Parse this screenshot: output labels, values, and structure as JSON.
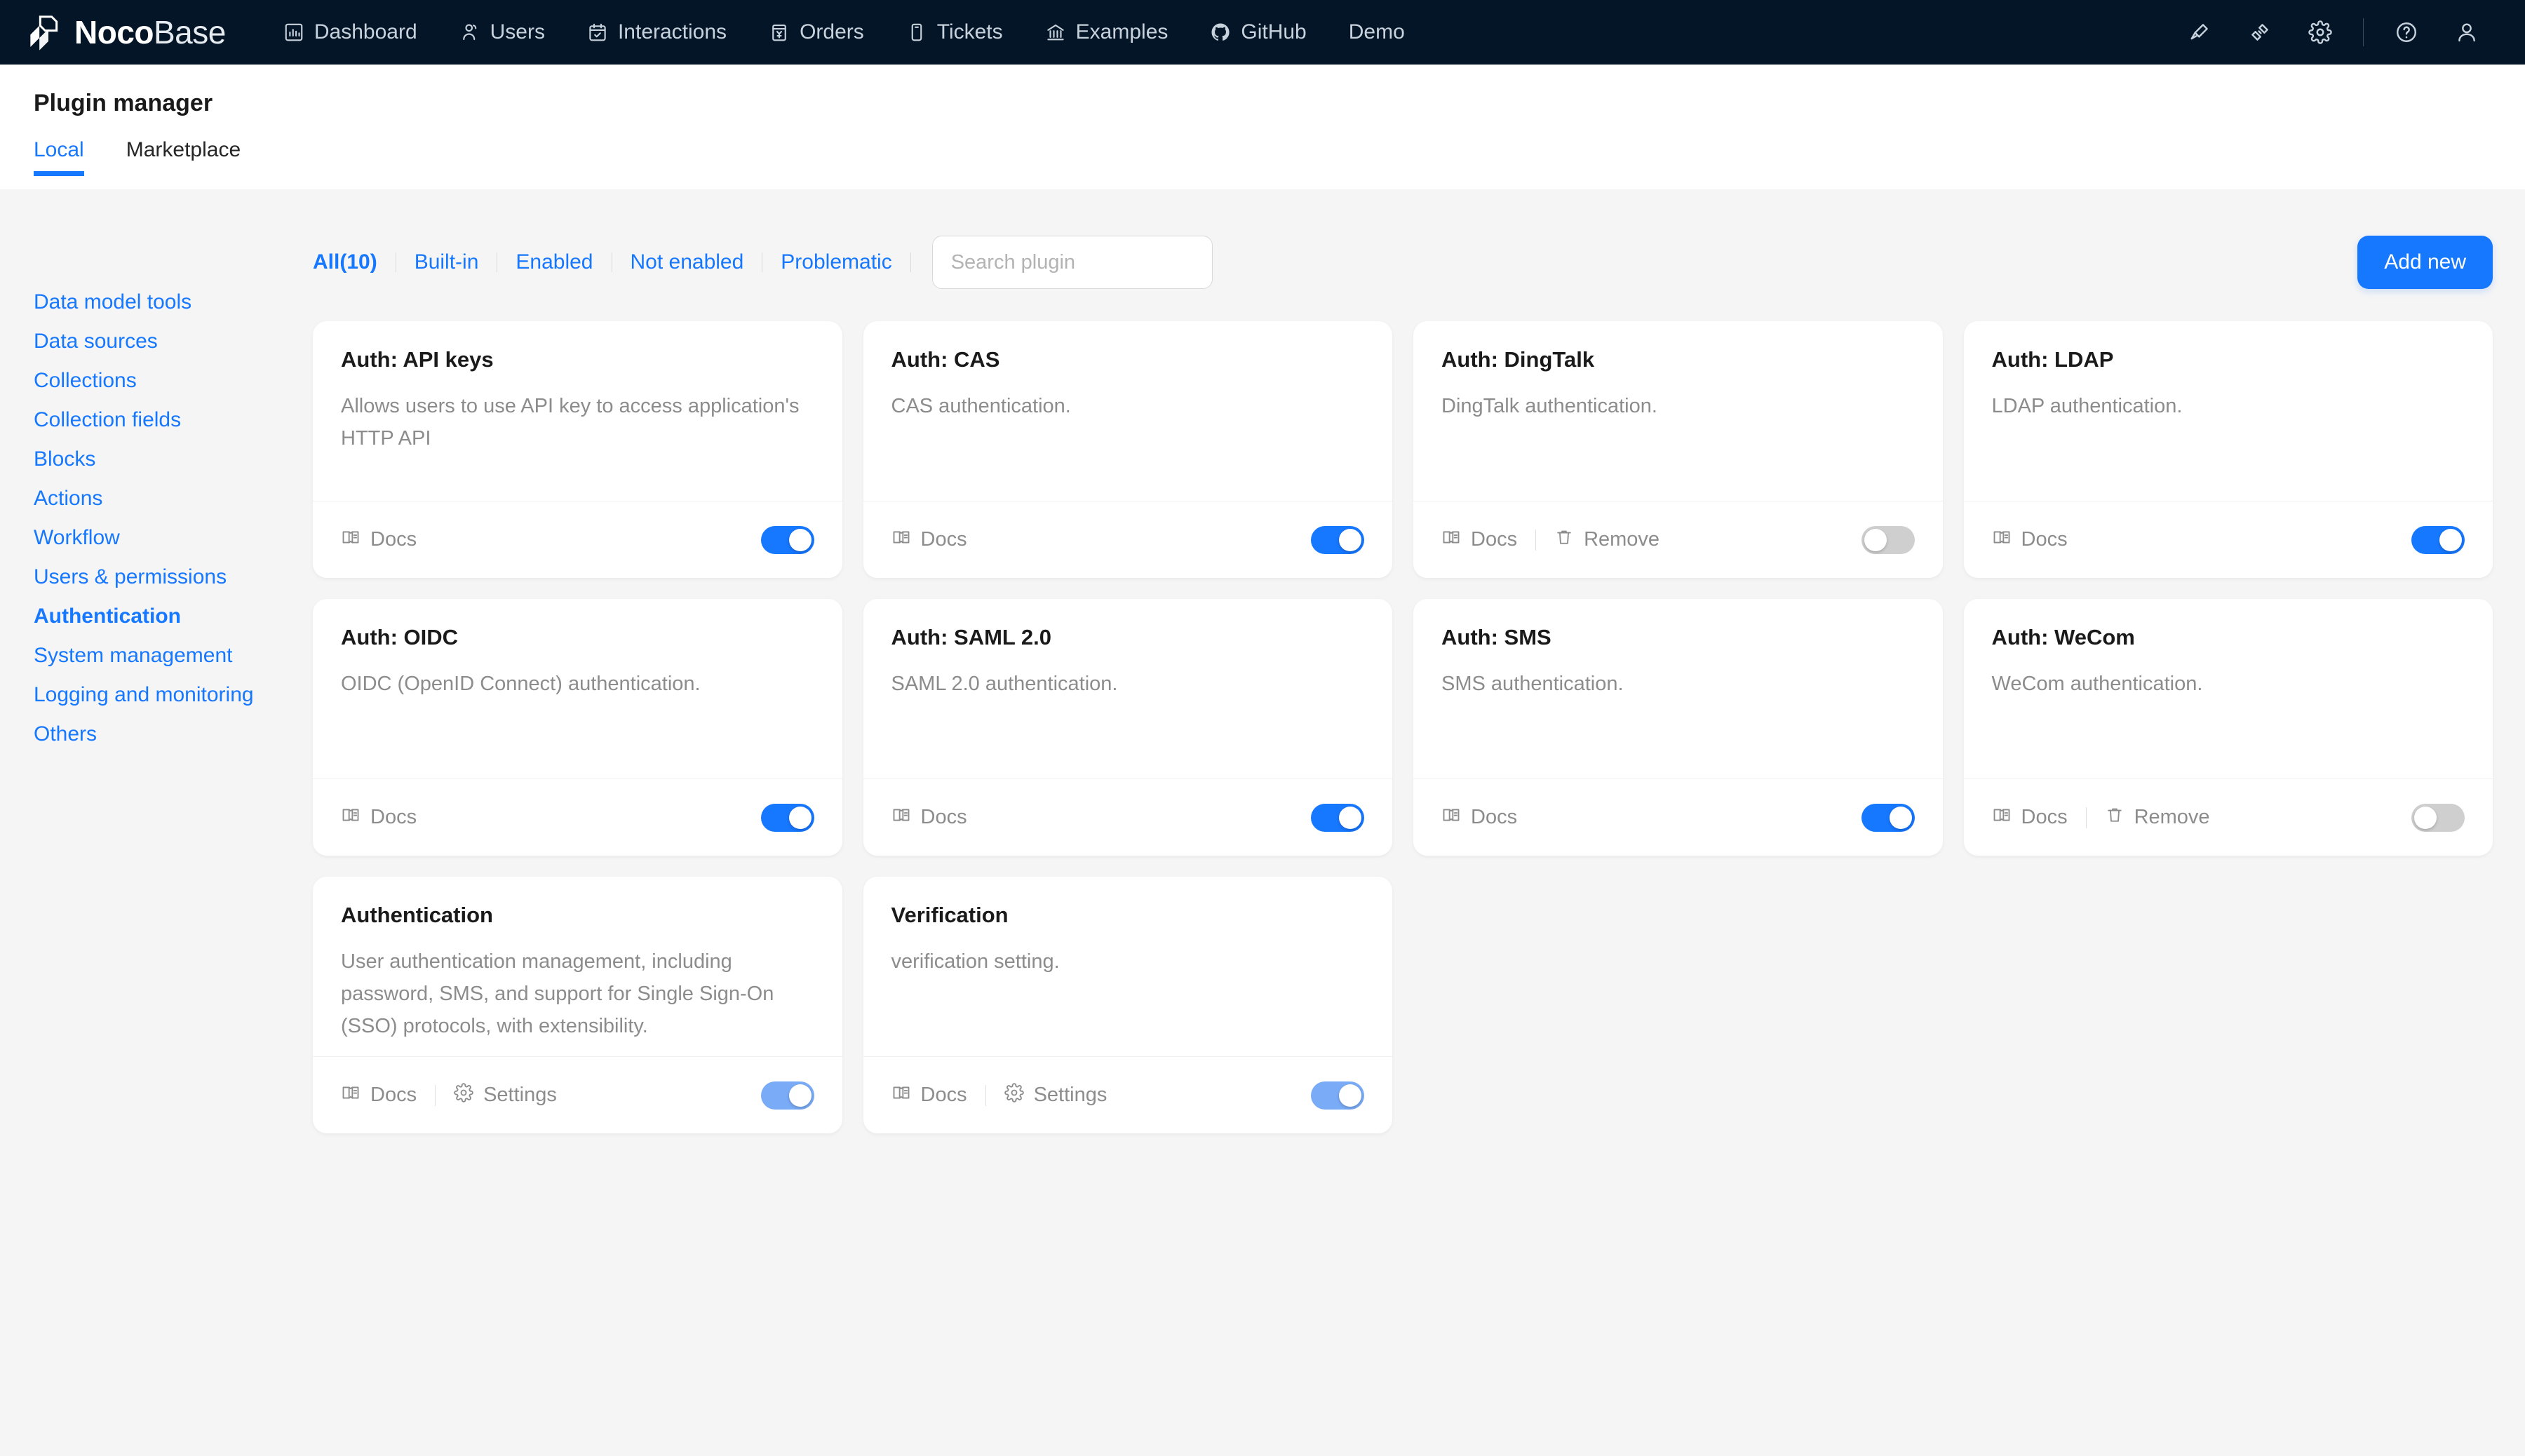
{
  "navbar": {
    "brand": {
      "bold": "Noco",
      "light": "Base",
      "logo_icon": "nocobase-logo-icon"
    },
    "items": [
      {
        "label": "Dashboard",
        "icon": "bar-chart-icon"
      },
      {
        "label": "Users",
        "icon": "users-icon"
      },
      {
        "label": "Interactions",
        "icon": "calendar-check-icon"
      },
      {
        "label": "Orders",
        "icon": "receipt-yen-icon"
      },
      {
        "label": "Tickets",
        "icon": "ticket-icon"
      },
      {
        "label": "Examples",
        "icon": "bank-icon"
      },
      {
        "label": "GitHub",
        "icon": "github-icon"
      },
      {
        "label": "Demo",
        "icon": ""
      }
    ],
    "right_icons": [
      {
        "name": "highlighter-icon"
      },
      {
        "name": "plugin-connector-icon"
      },
      {
        "name": "gear-icon"
      },
      {
        "name": "help-circle-icon"
      },
      {
        "name": "user-avatar-icon"
      }
    ]
  },
  "page": {
    "title": "Plugin manager",
    "tabs": [
      {
        "label": "Local",
        "active": true
      },
      {
        "label": "Marketplace",
        "active": false
      }
    ]
  },
  "sidebar": {
    "items": [
      {
        "label": "Data model tools",
        "active": false
      },
      {
        "label": "Data sources",
        "active": false
      },
      {
        "label": "Collections",
        "active": false
      },
      {
        "label": "Collection fields",
        "active": false
      },
      {
        "label": "Blocks",
        "active": false
      },
      {
        "label": "Actions",
        "active": false
      },
      {
        "label": "Workflow",
        "active": false
      },
      {
        "label": "Users & permissions",
        "active": false
      },
      {
        "label": "Authentication",
        "active": true
      },
      {
        "label": "System management",
        "active": false
      },
      {
        "label": "Logging and monitoring",
        "active": false
      },
      {
        "label": "Others",
        "active": false
      }
    ]
  },
  "toolbar": {
    "filters": [
      {
        "label": "All(10)",
        "active": true
      },
      {
        "label": "Built-in",
        "active": false
      },
      {
        "label": "Enabled",
        "active": false
      },
      {
        "label": "Not enabled",
        "active": false
      },
      {
        "label": "Problematic",
        "active": false
      }
    ],
    "search": {
      "value": "",
      "placeholder": "Search plugin"
    },
    "add_new_label": "Add new"
  },
  "labels": {
    "docs": "Docs",
    "remove": "Remove",
    "settings": "Settings"
  },
  "colors": {
    "accent": "#1677ff",
    "navbar_bg": "#041527",
    "page_bg": "#f5f5f5",
    "card_bg": "#ffffff",
    "toggle_on": "#1677ff",
    "toggle_on_dim": "#7aabf7",
    "toggle_off": "#bfbfbf",
    "muted_text": "#8c8c8c"
  },
  "plugins": [
    {
      "title": "Auth: API keys",
      "desc": "Allows users to use API key to access application's HTTP API",
      "actions": [
        "docs"
      ],
      "toggle": "on"
    },
    {
      "title": "Auth: CAS",
      "desc": "CAS authentication.",
      "actions": [
        "docs"
      ],
      "toggle": "on"
    },
    {
      "title": "Auth: DingTalk",
      "desc": "DingTalk authentication.",
      "actions": [
        "docs",
        "remove"
      ],
      "toggle": "off-dim"
    },
    {
      "title": "Auth: LDAP",
      "desc": "LDAP authentication.",
      "actions": [
        "docs"
      ],
      "toggle": "on"
    },
    {
      "title": "Auth: OIDC",
      "desc": "OIDC (OpenID Connect) authentication.",
      "actions": [
        "docs"
      ],
      "toggle": "on"
    },
    {
      "title": "Auth: SAML 2.0",
      "desc": "SAML 2.0 authentication.",
      "actions": [
        "docs"
      ],
      "toggle": "on"
    },
    {
      "title": "Auth: SMS",
      "desc": "SMS authentication.",
      "actions": [
        "docs"
      ],
      "toggle": "on"
    },
    {
      "title": "Auth: WeCom",
      "desc": "WeCom authentication.",
      "actions": [
        "docs",
        "remove"
      ],
      "toggle": "off-dim"
    },
    {
      "title": "Authentication",
      "desc": "User authentication management, including password, SMS, and support for Single Sign-On (SSO) protocols, with extensibility.",
      "actions": [
        "docs",
        "settings"
      ],
      "toggle": "on-dim"
    },
    {
      "title": "Verification",
      "desc": "verification setting.",
      "actions": [
        "docs",
        "settings"
      ],
      "toggle": "on-dim"
    }
  ]
}
